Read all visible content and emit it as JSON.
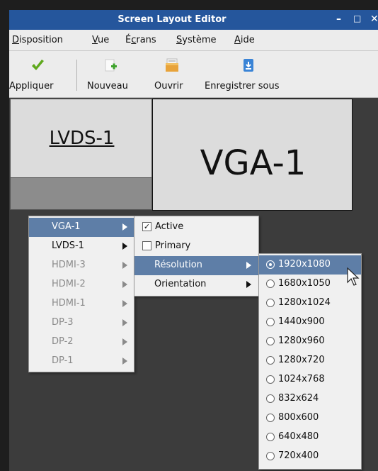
{
  "window": {
    "title": "Screen Layout Editor",
    "minimize": "–",
    "maximize": "□",
    "close": "✕"
  },
  "menubar": {
    "disposition": {
      "accel": "D",
      "rest": "isposition"
    },
    "vue": {
      "accel": "V",
      "rest": "ue"
    },
    "ecrans": {
      "pre": "É",
      "accel": "c",
      "rest": "rans"
    },
    "systeme": {
      "accel": "S",
      "rest": "ystème"
    },
    "aide": {
      "accel": "A",
      "rest": "ide"
    }
  },
  "toolbar": {
    "apply": "Appliquer",
    "new": "Nouveau",
    "open": "Ouvrir",
    "save_as": "Enregistrer sous",
    "icons": {
      "apply": "checkmark-icon",
      "new": "new-document-icon",
      "open": "folder-icon",
      "save_as": "save-icon"
    }
  },
  "screens": {
    "lvds": "LVDS-1",
    "vga": "VGA-1"
  },
  "outputs_menu": {
    "items": [
      {
        "label": "VGA-1",
        "state": "selected"
      },
      {
        "label": "LVDS-1",
        "state": "enabled"
      },
      {
        "label": "HDMI-3",
        "state": "disabled"
      },
      {
        "label": "HDMI-2",
        "state": "disabled"
      },
      {
        "label": "HDMI-1",
        "state": "disabled"
      },
      {
        "label": "DP-3",
        "state": "disabled"
      },
      {
        "label": "DP-2",
        "state": "disabled"
      },
      {
        "label": "DP-1",
        "state": "disabled"
      }
    ]
  },
  "output_submenu": {
    "active": {
      "label": "Active",
      "checked": true
    },
    "primary": {
      "label": "Primary",
      "checked": false
    },
    "resolution": "Résolution",
    "orientation": "Orientation",
    "check_mark": "✓"
  },
  "resolution_menu": {
    "selected": "1920x1080",
    "items": [
      "1920x1080",
      "1680x1050",
      "1280x1024",
      "1440x900",
      "1280x960",
      "1280x720",
      "1024x768",
      "832x624",
      "800x600",
      "640x480",
      "720x400"
    ]
  },
  "colors": {
    "titlebar": "#25569c",
    "highlight": "#5e7ea7",
    "apply_green": "#5ea81c",
    "new_green": "#3fa32d",
    "folder": "#e8a33a",
    "save_blue": "#3a84d6"
  }
}
